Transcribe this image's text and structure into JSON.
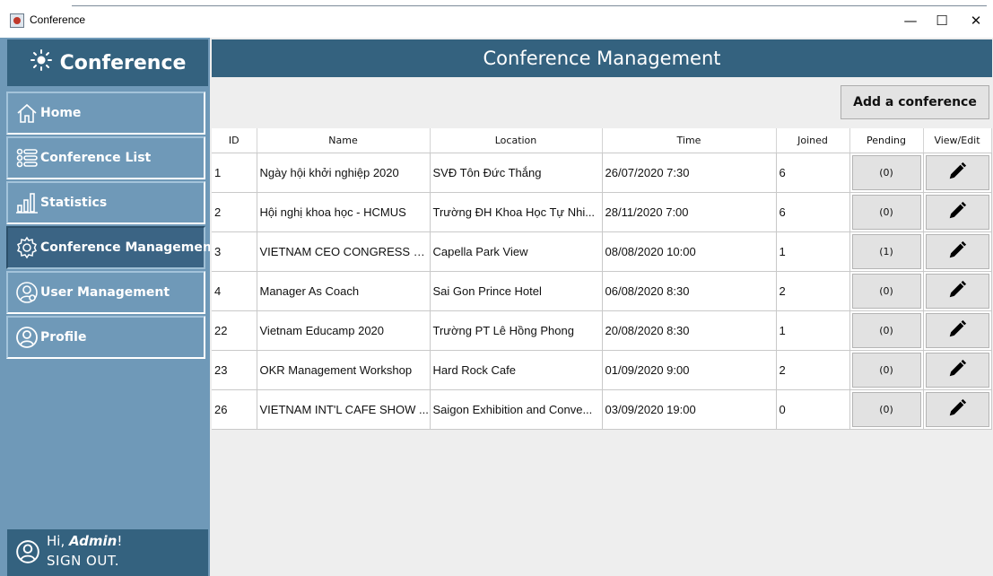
{
  "window": {
    "title": "Conference",
    "minimize": "—",
    "maximize": "☐",
    "close": "✕"
  },
  "sidebar": {
    "brand": "Conference",
    "items": [
      {
        "label": "Home",
        "icon": "home-icon"
      },
      {
        "label": "Conference List",
        "icon": "list-icon"
      },
      {
        "label": "Statistics",
        "icon": "chart-icon"
      },
      {
        "label": "Conference Management",
        "icon": "gear-icon",
        "active": true
      },
      {
        "label": "User Management",
        "icon": "user-gear-icon"
      },
      {
        "label": "Profile",
        "icon": "profile-icon"
      }
    ],
    "user": {
      "greeting_prefix": "Hi, ",
      "name": "Admin",
      "greeting_suffix": "!",
      "sign_out": "SIGN OUT."
    }
  },
  "main": {
    "header": "Conference Management",
    "add_button": "Add a conference",
    "table": {
      "columns": [
        "ID",
        "Name",
        "Location",
        "Time",
        "Joined",
        "Pending",
        "View/Edit"
      ],
      "rows": [
        {
          "id": "1",
          "name": "Ngày hội khởi nghiệp 2020",
          "location": "SVĐ Tôn Đức Thắng",
          "time": "26/07/2020 7:30",
          "joined": "6",
          "pending": "(0)"
        },
        {
          "id": "2",
          "name": "Hội nghị khoa học - HCMUS",
          "location": "Trường ĐH Khoa Học Tự Nhi...",
          "time": "28/11/2020 7:00",
          "joined": "6",
          "pending": "(0)"
        },
        {
          "id": "3",
          "name": "VIETNAM CEO CONGRESS 2...",
          "location": "Capella Park View",
          "time": "08/08/2020 10:00",
          "joined": "1",
          "pending": "(1)"
        },
        {
          "id": "4",
          "name": "Manager As Coach",
          "location": "Sai Gon Prince Hotel",
          "time": "06/08/2020 8:30",
          "joined": "2",
          "pending": "(0)"
        },
        {
          "id": "22",
          "name": "Vietnam Educamp 2020",
          "location": "Trường PT Lê Hồng Phong",
          "time": "20/08/2020 8:30",
          "joined": "1",
          "pending": "(0)"
        },
        {
          "id": "23",
          "name": "OKR Management Workshop",
          "location": "Hard Rock Cafe",
          "time": "01/09/2020 9:00",
          "joined": "2",
          "pending": "(0)"
        },
        {
          "id": "26",
          "name": "VIETNAM INT'L CAFE SHOW ...",
          "location": "Saigon Exhibition and Conve...",
          "time": "03/09/2020 19:00",
          "joined": "0",
          "pending": "(0)"
        }
      ]
    }
  },
  "colors": {
    "sidebar_bg": "#6f99b8",
    "header_bg": "#34627f",
    "active_item_bg": "#3b6484"
  }
}
